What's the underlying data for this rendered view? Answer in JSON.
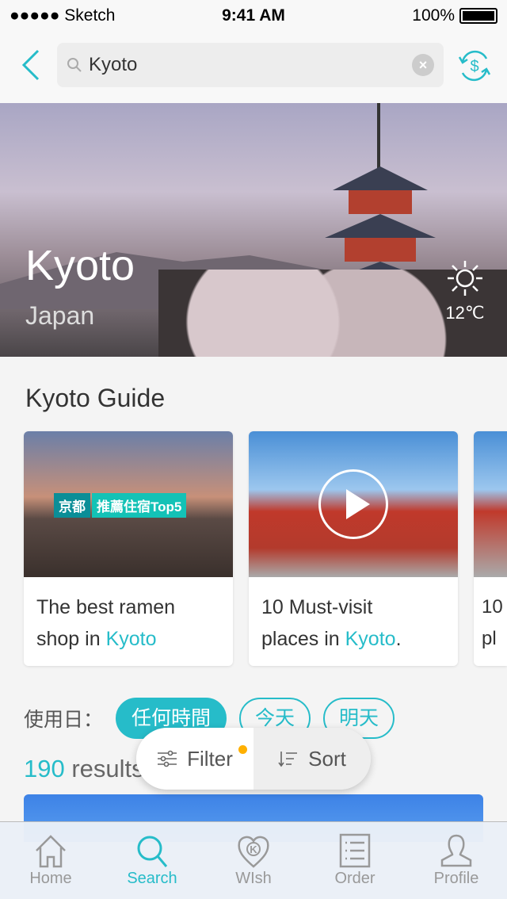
{
  "status": {
    "carrier": "●●●●● Sketch",
    "time": "9:41 AM",
    "battery": "100%"
  },
  "search": {
    "value": "Kyoto",
    "clear": "×"
  },
  "hero": {
    "city": "Kyoto",
    "country": "Japan",
    "temperature": "12℃"
  },
  "guide": {
    "title": "Kyoto Guide",
    "cards": [
      {
        "line1": "The best ramen",
        "line2_pre": "shop in ",
        "highlight": "Kyoto",
        "line2_post": "",
        "badge_city": "京都",
        "badge_text": "推薦住宿Top5"
      },
      {
        "line1": "10 Must-visit",
        "line2_pre": "places in ",
        "highlight": "Kyoto",
        "line2_post": "."
      },
      {
        "line1": "10",
        "line2_pre": "pla",
        "highlight": "",
        "line2_post": ""
      }
    ]
  },
  "dates": {
    "label": "使用日：",
    "options": [
      "任何時間",
      "今天",
      "明天"
    ]
  },
  "results": {
    "count": "190",
    "label": " results"
  },
  "actions": {
    "filter": "Filter",
    "sort": "Sort"
  },
  "tabs": [
    "Home",
    "Search",
    "WIsh",
    "Order",
    "Profile"
  ],
  "colors": {
    "accent": "#26bcc9",
    "badge": "#ffb000"
  }
}
